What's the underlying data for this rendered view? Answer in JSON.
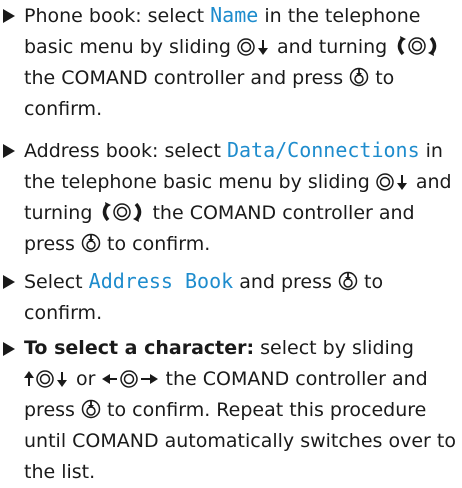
{
  "steps": [
    {
      "a": "Phone book: select ",
      "b": "Name",
      "c": " in the telephone basic menu by sliding ",
      "d": " and turning ",
      "e": " the COMAND controller and press ",
      "f": " to confirm."
    },
    {
      "a": "Address book: select ",
      "b": "Data/Connections",
      "c": " in the telephone basic menu by sliding ",
      "d": " and turning ",
      "e": " the COMAND controller and press ",
      "f": " to confirm."
    },
    {
      "a": "Select ",
      "b": "Address Book",
      "c": " and press ",
      "d": " to confirm."
    },
    {
      "a": "To select a character:",
      "b": " select by sliding ",
      "c": " or ",
      "d": " the COMAND controller and press ",
      "e": " to confirm. Repeat this procedure until COMAND automatically switches over to the list."
    }
  ],
  "colors": {
    "highlight": "#1e8ccd",
    "text": "#1a1a1a"
  },
  "icons": [
    "slide-down-icon",
    "rotate-icon",
    "press-icon",
    "slide-up-down-icon",
    "slide-left-right-icon"
  ]
}
